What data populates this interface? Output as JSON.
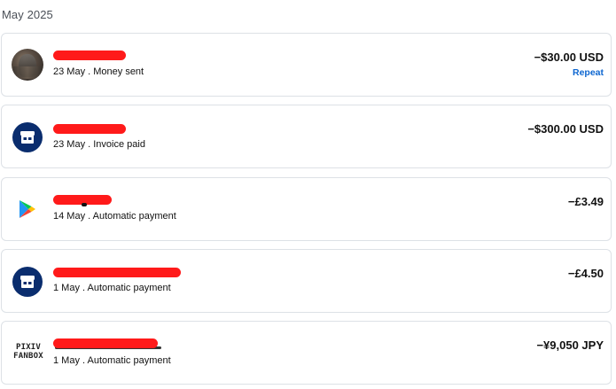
{
  "month_heading": "May 2025",
  "transactions": [
    {
      "icon": "user-avatar",
      "name": "",
      "subtitle": "23 May . Money sent",
      "amount": "−$30.00 USD",
      "action": "Repeat"
    },
    {
      "icon": "storefront-icon",
      "name": "",
      "subtitle": "23 May . Invoice paid",
      "amount": "−$300.00 USD"
    },
    {
      "icon": "google-play-icon",
      "name": "",
      "subtitle": "14 May . Automatic payment",
      "amount": "−£3.49"
    },
    {
      "icon": "storefront-icon",
      "name": "",
      "subtitle": "1 May . Automatic payment",
      "amount": "−£4.50"
    },
    {
      "icon": "pixiv-fanbox-logo",
      "logo_text": [
        "PIXIV",
        "FANBOX"
      ],
      "name": "",
      "subtitle": "1 May . Automatic payment",
      "amount": "−¥9,050 JPY"
    }
  ],
  "colors": {
    "redaction": "#ff1a1a",
    "store_badge": "#0a2d6e",
    "link": "#0d66d0",
    "border": "#dde1e6"
  }
}
